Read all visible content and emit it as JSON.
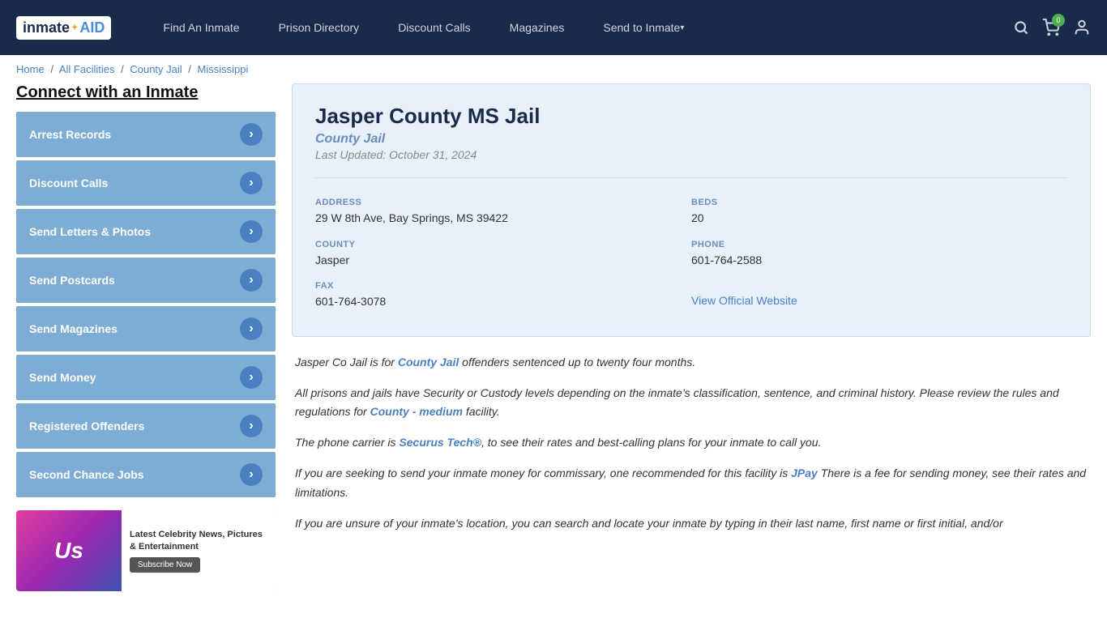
{
  "nav": {
    "logo_inmate": "inmate",
    "logo_aid": "AID",
    "links": [
      {
        "label": "Find An Inmate",
        "id": "find-inmate"
      },
      {
        "label": "Prison Directory",
        "id": "prison-directory"
      },
      {
        "label": "Discount Calls",
        "id": "discount-calls"
      },
      {
        "label": "Magazines",
        "id": "magazines"
      },
      {
        "label": "Send to Inmate",
        "id": "send-to-inmate",
        "caret": true
      }
    ],
    "cart_count": "0"
  },
  "breadcrumb": {
    "home": "Home",
    "all_facilities": "All Facilities",
    "county_jail": "County Jail",
    "state": "Mississippi"
  },
  "sidebar": {
    "title": "Connect with an Inmate",
    "buttons": [
      {
        "label": "Arrest Records",
        "id": "arrest-records"
      },
      {
        "label": "Discount Calls",
        "id": "discount-calls-btn"
      },
      {
        "label": "Send Letters & Photos",
        "id": "send-letters"
      },
      {
        "label": "Send Postcards",
        "id": "send-postcards"
      },
      {
        "label": "Send Magazines",
        "id": "send-magazines"
      },
      {
        "label": "Send Money",
        "id": "send-money"
      },
      {
        "label": "Registered Offenders",
        "id": "registered-offenders"
      },
      {
        "label": "Second Chance Jobs",
        "id": "second-chance-jobs"
      }
    ],
    "ad": {
      "brand": "Us",
      "headline": "Latest Celebrity News, Pictures & Entertainment",
      "subscribe": "Subscribe Now"
    }
  },
  "facility": {
    "name": "Jasper County MS Jail",
    "type": "County Jail",
    "last_updated": "Last Updated: October 31, 2024",
    "address_label": "ADDRESS",
    "address_value": "29 W 8th Ave, Bay Springs, MS 39422",
    "beds_label": "BEDS",
    "beds_value": "20",
    "county_label": "COUNTY",
    "county_value": "Jasper",
    "phone_label": "PHONE",
    "phone_value": "601-764-2588",
    "fax_label": "FAX",
    "fax_value": "601-764-3078",
    "website_label": "View Official Website",
    "website_url": "#"
  },
  "description": {
    "para1_pre": "Jasper Co Jail is for ",
    "para1_bold": "County Jail",
    "para1_post": " offenders sentenced up to twenty four months.",
    "para2": "All prisons and jails have Security or Custody levels depending on the inmate’s classification, sentence, and criminal history. Please review the rules and regulations for ",
    "para2_bold": "County - medium",
    "para2_post": " facility.",
    "para3_pre": "The phone carrier is ",
    "para3_bold": "Securus Tech®",
    "para3_post": ", to see their rates and best-calling plans for your inmate to call you.",
    "para4_pre": "If you are seeking to send your inmate money for commissary, one recommended for this facility is ",
    "para4_bold": "JPay",
    "para4_post": " There is a fee for sending money, see their rates and limitations.",
    "para5": "If you are unsure of your inmate’s location, you can search and locate your inmate by typing in their last name, first name or first initial, and/or"
  }
}
